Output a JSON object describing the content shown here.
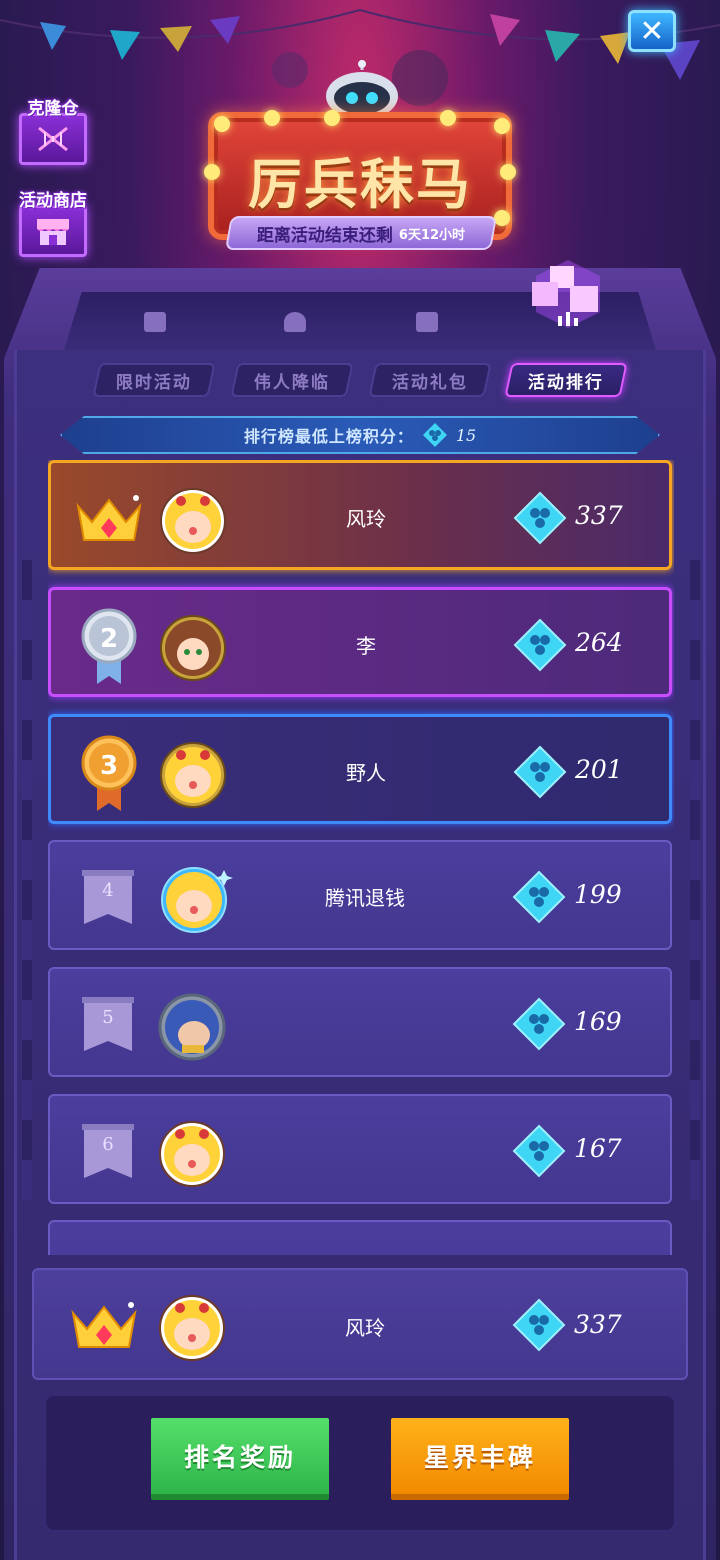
{
  "header": {
    "title": "厉兵秣马",
    "countdown_label": "距离活动结束还剩",
    "countdown_value": "6天12小时",
    "close_icon": "close-icon",
    "side_buttons": [
      {
        "label": "克隆仓",
        "icon": "dna-icon"
      },
      {
        "label": "活动商店",
        "icon": "shop-icon"
      }
    ]
  },
  "tabs": [
    {
      "label": "限时活动",
      "active": false
    },
    {
      "label": "伟人降临",
      "active": false
    },
    {
      "label": "活动礼包",
      "active": false
    },
    {
      "label": "活动排行",
      "active": true
    }
  ],
  "min_score": {
    "label": "排行榜最低上榜积分：",
    "value": "15"
  },
  "leaderboard": [
    {
      "rank": "1",
      "rank_style": "crown",
      "name": "风玲",
      "score": "337",
      "avatar": "blonde-bow"
    },
    {
      "rank": "2",
      "rank_style": "silver-medal",
      "name": "李",
      "score": "264",
      "avatar": "brown-hair"
    },
    {
      "rank": "3",
      "rank_style": "bronze-medal",
      "name": "野人",
      "score": "201",
      "avatar": "blonde-bow"
    },
    {
      "rank": "4",
      "rank_style": "flag",
      "name": "腾讯退钱",
      "score": "199",
      "avatar": "blonde-bow-sparkle"
    },
    {
      "rank": "5",
      "rank_style": "flag",
      "name": "",
      "score": "169",
      "avatar": "blue-hair"
    },
    {
      "rank": "6",
      "rank_style": "flag",
      "name": "",
      "score": "167",
      "avatar": "blonde-bow"
    }
  ],
  "my_rank": {
    "rank": "1",
    "name": "风玲",
    "score": "337"
  },
  "buttons": {
    "rank_reward": "排名奖励",
    "star_monument": "星界丰碑"
  },
  "colors": {
    "gold": "#f5a623",
    "purple": "#c74dff",
    "blue": "#3d8bff",
    "green": "#2fb54a",
    "orange": "#f28a00"
  }
}
